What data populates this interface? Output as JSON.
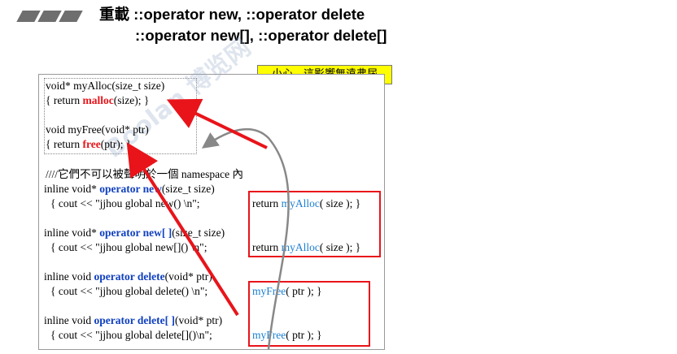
{
  "title": {
    "line1": "重載 ::operator new,  ::operator delete",
    "line2": "::operator new[], ::operator delete[]"
  },
  "callout": "小心，這影響無遠弗屆",
  "watermark": "Boolan 博览网",
  "code": {
    "alloc_sig": "void* myAlloc(size_t size)",
    "alloc_body_pre": "{  return ",
    "alloc_body_fn": "malloc",
    "alloc_body_post": "(size); }",
    "free_sig": "void myFree(void* ptr)",
    "free_body_pre": "{  return ",
    "free_body_fn": "free",
    "free_body_post": "(ptr); }",
    "comment": "////它們不可以被聲明於一個 namespace 內",
    "new_pre": "inline void* ",
    "new_kw": "operator new",
    "new_post": "(size_t size)",
    "new_cout": "{ cout << \"jjhou global new()     \\n\";",
    "new_ret_pre": "return ",
    "new_ret_fn": "myAlloc",
    "new_ret_post": "( size ); }",
    "newarr_pre": "inline void* ",
    "newarr_kw": "operator new[ ]",
    "newarr_post": "(size_t size)",
    "newarr_cout": "{ cout << \"jjhou global new[]()   \\n\";",
    "newarr_ret_pre": "return ",
    "newarr_ret_fn": "myAlloc",
    "newarr_ret_post": "( size ); }",
    "del_pre": "inline void  ",
    "del_kw": "operator delete",
    "del_post": "(void* ptr)",
    "del_cout": "{ cout << \"jjhou global delete()  \\n\";",
    "del_ret_fn": "myFree",
    "del_ret_post": "( ptr );   }",
    "delarr_pre": "inline void  ",
    "delarr_kw": "operator delete[ ]",
    "delarr_post": "(void* ptr)",
    "delarr_cout": "{ cout << \"jjhou global delete[]()\\n\";",
    "delarr_ret_fn": "myFree",
    "delarr_ret_post": "( ptr );   }"
  },
  "colors": {
    "red": "#e8141a",
    "blue": "#1040c0",
    "light_blue": "#1b7fd0",
    "callout_bg": "#ffff00"
  }
}
